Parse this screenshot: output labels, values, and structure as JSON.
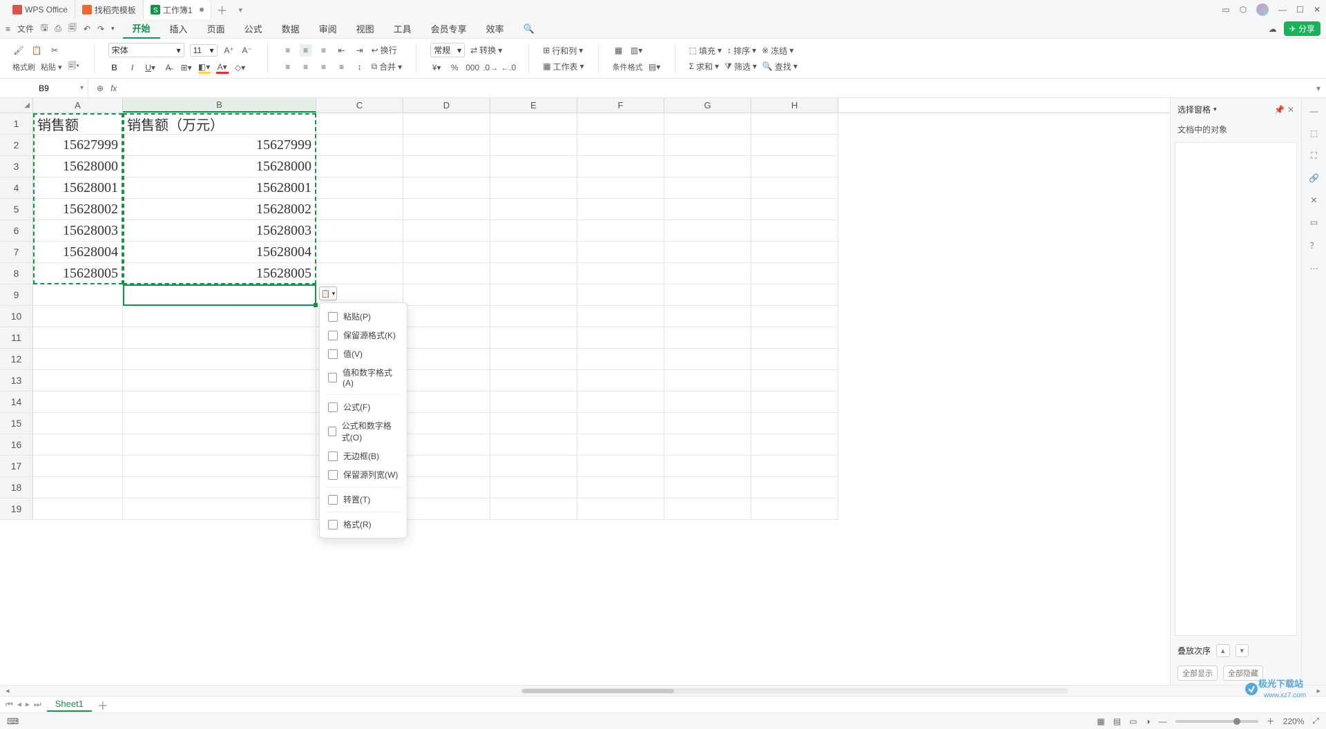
{
  "tabs": {
    "t1": "WPS Office",
    "t2": "找稻壳模板",
    "t3": "工作簿1"
  },
  "menu": {
    "file": "文件",
    "items": [
      "开始",
      "插入",
      "页面",
      "公式",
      "数据",
      "审阅",
      "视图",
      "工具",
      "会员专享",
      "效率"
    ]
  },
  "share": "分享",
  "ribbon": {
    "fmt_brush": "格式刷",
    "paste": "粘贴",
    "font": "宋体",
    "size": "11",
    "general": "常规",
    "convert": "转换",
    "rowcol": "行和列",
    "worksheet": "工作表",
    "cond_fmt": "条件格式",
    "fill": "填充",
    "sort": "排序",
    "freeze": "冻结",
    "sum": "求和",
    "filter": "筛选",
    "find": "查找",
    "wrap": "换行",
    "merge": "合并"
  },
  "fx": {
    "cellname": "B9"
  },
  "cols": [
    "A",
    "B",
    "C",
    "D",
    "E",
    "F",
    "G",
    "H"
  ],
  "data": {
    "h1": "销售额",
    "h2": "销售额（万元）",
    "r": [
      {
        "a": "15627999",
        "b": "15627999"
      },
      {
        "a": "15628000",
        "b": "15628000"
      },
      {
        "a": "15628001",
        "b": "15628001"
      },
      {
        "a": "15628002",
        "b": "15628002"
      },
      {
        "a": "15628003",
        "b": "15628003"
      },
      {
        "a": "15628004",
        "b": "15628004"
      },
      {
        "a": "15628005",
        "b": "15628005"
      }
    ]
  },
  "paste_menu": {
    "paste": "粘贴(P)",
    "keepfmt": "保留源格式(K)",
    "value": "值(V)",
    "valnum": "值和数字格式(A)",
    "formula": "公式(F)",
    "formnum": "公式和数字格式(O)",
    "noborder": "无边框(B)",
    "keepcolw": "保留源列宽(W)",
    "transpose": "转置(T)",
    "fmt": "格式(R)"
  },
  "panel": {
    "title": "选择窗格",
    "sub": "文档中的对象",
    "stack": "叠放次序",
    "showall": "全部显示",
    "hideall": "全部隐藏"
  },
  "sheet": {
    "name": "Sheet1"
  },
  "status": {
    "zoom": "220%"
  },
  "watermark": {
    "l1": "极光下载站",
    "l2": "www.xz7.com"
  }
}
